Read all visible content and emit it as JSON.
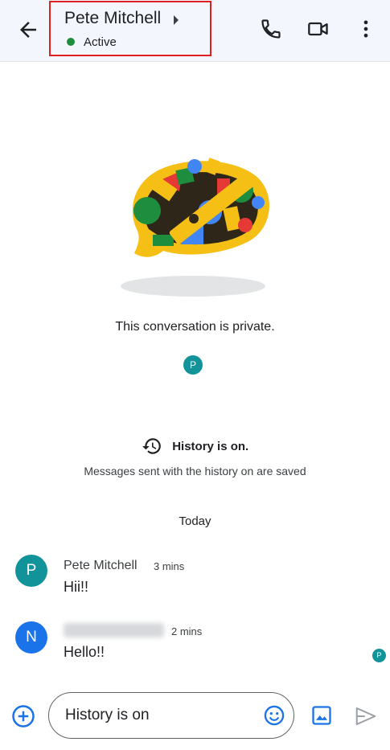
{
  "header": {
    "contact_name": "Pete Mitchell",
    "status": "Active",
    "status_color": "#1e8e3e",
    "icons": [
      "back-arrow-icon",
      "phone-icon",
      "video-call-icon",
      "more-vert-icon"
    ]
  },
  "intro": {
    "private_text": "This conversation is private.",
    "member_initial": "P"
  },
  "history": {
    "title": "History is on.",
    "subtitle": "Messages sent with the history on are saved"
  },
  "day_label": "Today",
  "messages": [
    {
      "initial": "P",
      "sender": "Pete Mitchell",
      "time": "3 mins",
      "text": "Hii!!",
      "avatar_color": "#12939a"
    },
    {
      "initial": "N",
      "sender": "",
      "time": "2 mins",
      "text": "Hello!!",
      "avatar_color": "#1a73e8"
    }
  ],
  "read_receipt_initial": "P",
  "composer": {
    "value": "History is on"
  },
  "colors": {
    "accent": "#1a73e8",
    "highlight_border": "#e02020",
    "header_bg": "#f3f6fc"
  }
}
